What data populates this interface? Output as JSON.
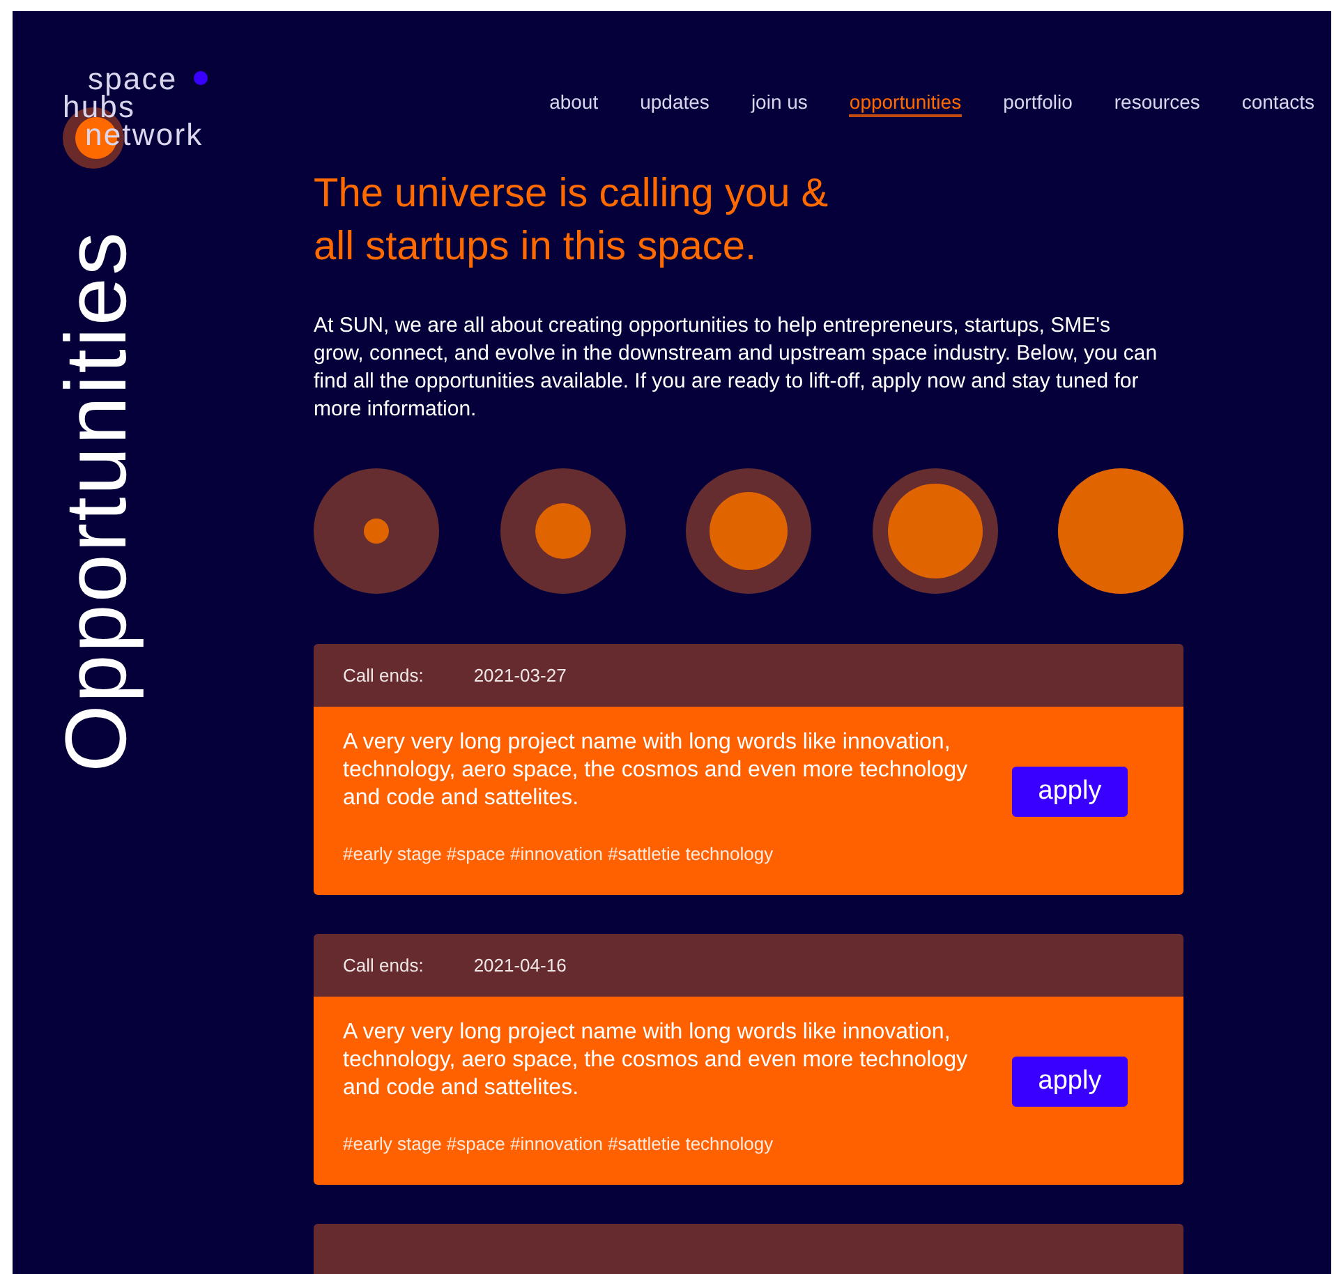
{
  "logo": {
    "lines": [
      "space",
      "hubs",
      "network"
    ]
  },
  "nav": [
    {
      "label": "about",
      "selected": false
    },
    {
      "label": "updates",
      "selected": false
    },
    {
      "label": "join us",
      "selected": false
    },
    {
      "label": "opportunities",
      "selected": true
    },
    {
      "label": "portfolio",
      "selected": false
    },
    {
      "label": "resources",
      "selected": false
    },
    {
      "label": "contacts",
      "selected": false
    }
  ],
  "page_title": "Opportunities",
  "headline": [
    "The universe is calling you &",
    "all startups in this space."
  ],
  "intro": "At SUN, we are all about creating opportunities to help entrepreneurs, startups, SME's grow, connect, and evolve in the downstream and upstream space industry. Below, you can find all the opportunities available. If you are ready to lift-off, apply now and stay tuned for more information.",
  "cards": [
    {
      "kind": "full",
      "call_label": "Call ends:",
      "date": "2021-03-27",
      "title": "A very very long project name with long words like innovation, technology, aero space, the cosmos and even more technology and code and sattelites.",
      "tags": "#early stage #space #innovation #sattletie technology",
      "button": "apply"
    },
    {
      "kind": "full",
      "call_label": "Call ends:",
      "date": "2021-04-16",
      "title": "A very very long project name with long words like innovation, technology, aero space, the cosmos and even more technology and code and sattelites.",
      "tags": "#early stage #space #innovation #sattletie technology",
      "button": "apply"
    },
    {
      "kind": "cut"
    }
  ]
}
